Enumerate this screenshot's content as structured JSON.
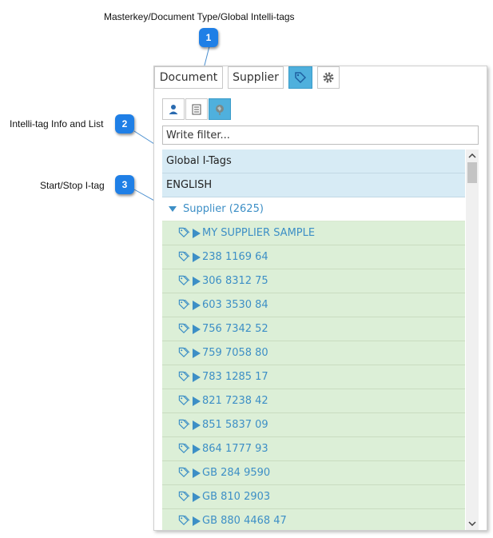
{
  "annotations": [
    {
      "number": "1",
      "label": "Masterkey/Document Type/Global Intelli-tags"
    },
    {
      "number": "2",
      "label": "Intelli-tag Info and List"
    },
    {
      "number": "3",
      "label": "Start/Stop I-tag"
    }
  ],
  "toolbar": {
    "tabs": [
      {
        "label": "Document",
        "active": false
      },
      {
        "label": "Supplier",
        "active": false
      }
    ],
    "tag_button_icon": "tag-icon",
    "settings_button_icon": "gear-icon"
  },
  "subtoolbar": [
    {
      "icon": "user-icon",
      "active": false
    },
    {
      "icon": "document-list-icon",
      "active": false
    },
    {
      "icon": "global-tags-icon",
      "active": true
    }
  ],
  "filter": {
    "placeholder": "Write filter...",
    "value": ""
  },
  "list": {
    "headers": [
      "Global I-Tags",
      "ENGLISH"
    ],
    "group": {
      "label": "Supplier (2625)",
      "expanded": true
    },
    "items": [
      "MY SUPPLIER SAMPLE",
      "238 1169 64",
      "306 8312 75",
      "603 3530 84",
      "756 7342 52",
      "759 7058 80",
      "783 1285 17",
      "821 7238 42",
      "851 5837 09",
      "864 1777 93",
      "GB 284 9590",
      "GB 810 2903",
      "GB 880 4468 47"
    ]
  },
  "colors": {
    "accent": "#4fb0dd",
    "badge": "#1f7fe6",
    "item_bg": "#dcefd7",
    "header_bg": "#d7ebf5",
    "link_text": "#3d8fc6"
  }
}
